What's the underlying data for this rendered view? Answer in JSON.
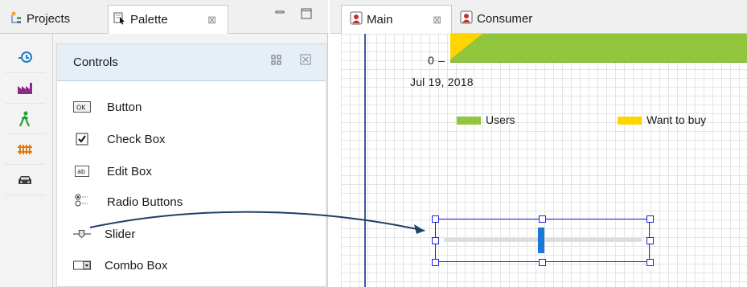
{
  "left_view": {
    "tabs": [
      {
        "label": "Projects"
      },
      {
        "label": "Palette",
        "close": "⊠"
      }
    ],
    "minimize_icon": "minimize-icon",
    "maximize_icon": "maximize-icon",
    "side_icons": [
      "time-plot-icon",
      "factory-icon",
      "person-icon",
      "rail-yard-icon",
      "car-icon"
    ],
    "controls": {
      "title": "Controls",
      "items": [
        {
          "label": "Button"
        },
        {
          "label": "Check Box"
        },
        {
          "label": "Edit Box"
        },
        {
          "label": "Radio Buttons"
        },
        {
          "label": "Slider"
        },
        {
          "label": "Combo Box"
        }
      ]
    }
  },
  "right_view": {
    "tabs": [
      {
        "label": "Main"
      },
      {
        "label": "Consumer"
      }
    ],
    "chart": {
      "axis_zero": "0",
      "axis_date": "Jul 19, 2018",
      "legend": [
        {
          "label": "Users",
          "color": "#8fc63b"
        },
        {
          "label": "Want to buy",
          "color": "#ffd400"
        }
      ]
    }
  },
  "colors": {
    "selection": "#2222dd",
    "slider_thumb": "#1a78d6",
    "arrow": "#1f3f66"
  }
}
